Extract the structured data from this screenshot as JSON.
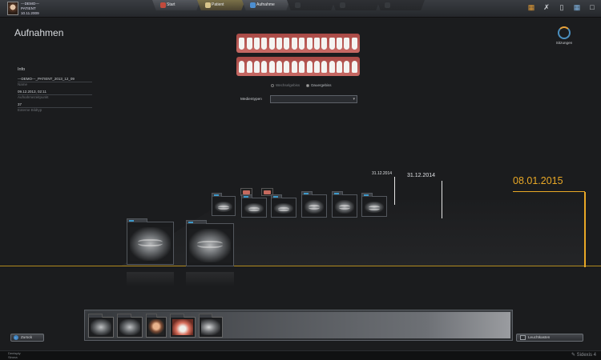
{
  "patient": {
    "line1": "---DEMO---",
    "line2": "PATIENT",
    "line3": "10.11.2009"
  },
  "nav": {
    "tabs": [
      {
        "label": "Start",
        "state": "normal"
      },
      {
        "label": "Patient",
        "state": "active"
      },
      {
        "label": "Aufnahme",
        "state": "normal"
      },
      {
        "label": "",
        "state": "disabled"
      },
      {
        "label": "",
        "state": "disabled"
      },
      {
        "label": "",
        "state": "disabled"
      }
    ]
  },
  "top_icons": [
    "folder-icon",
    "tools-icon",
    "trash-icon",
    "windows-icon",
    "close-icon"
  ],
  "page_title": "Aufnahmen",
  "info": {
    "heading": "Info",
    "name_value": "---DEMO---_PATIENT_2013_12_09",
    "name_label": "Name",
    "date_value": "09.12.2013, 02:11",
    "date_label": "Aufnahmezeitpunkt",
    "count_value": "37",
    "count_label": "Externe Bildtyp"
  },
  "dental": {
    "options": [
      {
        "label": "Wechselgebiss",
        "selected": false
      },
      {
        "label": "Dauergebiss",
        "selected": true
      }
    ]
  },
  "media": {
    "label": "Medientypen",
    "value": ""
  },
  "sitzungen": {
    "label": "Sitzungen"
  },
  "timeline": {
    "dates": [
      "31.12.2014",
      "31.12.2014",
      "08.01.2015"
    ]
  },
  "buttons": {
    "back": "Zurück",
    "lightbox": "Leuchtkasten"
  },
  "statusbar": {
    "left_line1": "Dentsply",
    "left_line2": "Sirona",
    "right": "Sidexis 4"
  },
  "colors": {
    "accent": "#e9a826",
    "tab_active": "#7a7048",
    "blue": "#3f86c6"
  }
}
